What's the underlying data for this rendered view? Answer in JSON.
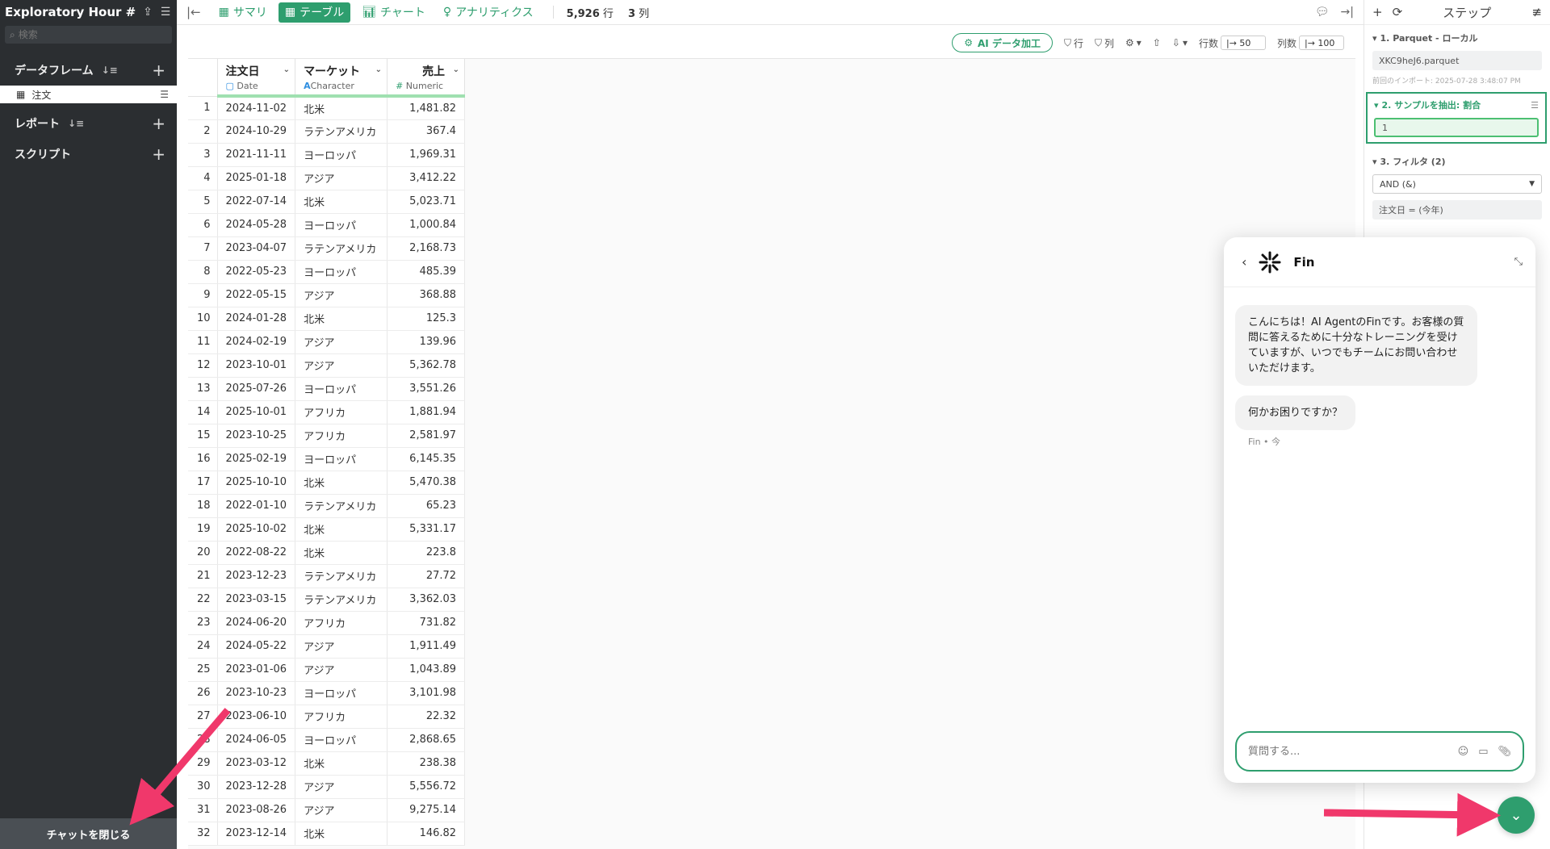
{
  "sidebar": {
    "title": "Exploratory Hour #...",
    "search_placeholder": "検索",
    "dataframes_label": "データフレーム",
    "dataframe_item": "注文",
    "reports_label": "レポート",
    "scripts_label": "スクリプト",
    "close_chat_label": "チャットを閉じる"
  },
  "toolbar": {
    "tabs": [
      "サマリ",
      "テーブル",
      "チャート",
      "アナリティクス"
    ],
    "rows_count": "5,926",
    "rows_unit": "行",
    "cols_count": "3",
    "cols_unit": "列"
  },
  "toolbar2": {
    "ai_label": "AI データ加工",
    "row_filter": "行",
    "col_filter": "列",
    "rows_label": "行数",
    "rows_value": "50",
    "cols_label": "列数",
    "cols_value": "100"
  },
  "table": {
    "columns": [
      {
        "name": "注文日",
        "type": "Date"
      },
      {
        "name": "マーケット",
        "type": "Character"
      },
      {
        "name": "売上",
        "type": "Numeric"
      }
    ],
    "rows": [
      [
        "1",
        "2024-11-02",
        "北米",
        "1,481.82"
      ],
      [
        "2",
        "2024-10-29",
        "ラテンアメリカ",
        "367.4"
      ],
      [
        "3",
        "2021-11-11",
        "ヨーロッパ",
        "1,969.31"
      ],
      [
        "4",
        "2025-01-18",
        "アジア",
        "3,412.22"
      ],
      [
        "5",
        "2022-07-14",
        "北米",
        "5,023.71"
      ],
      [
        "6",
        "2024-05-28",
        "ヨーロッパ",
        "1,000.84"
      ],
      [
        "7",
        "2023-04-07",
        "ラテンアメリカ",
        "2,168.73"
      ],
      [
        "8",
        "2022-05-23",
        "ヨーロッパ",
        "485.39"
      ],
      [
        "9",
        "2022-05-15",
        "アジア",
        "368.88"
      ],
      [
        "10",
        "2024-01-28",
        "北米",
        "125.3"
      ],
      [
        "11",
        "2024-02-19",
        "アジア",
        "139.96"
      ],
      [
        "12",
        "2023-10-01",
        "アジア",
        "5,362.78"
      ],
      [
        "13",
        "2025-07-26",
        "ヨーロッパ",
        "3,551.26"
      ],
      [
        "14",
        "2025-10-01",
        "アフリカ",
        "1,881.94"
      ],
      [
        "15",
        "2023-10-25",
        "アフリカ",
        "2,581.97"
      ],
      [
        "16",
        "2025-02-19",
        "ヨーロッパ",
        "6,145.35"
      ],
      [
        "17",
        "2025-10-10",
        "北米",
        "5,470.38"
      ],
      [
        "18",
        "2022-01-10",
        "ラテンアメリカ",
        "65.23"
      ],
      [
        "19",
        "2025-10-02",
        "北米",
        "5,331.17"
      ],
      [
        "20",
        "2022-08-22",
        "北米",
        "223.8"
      ],
      [
        "21",
        "2023-12-23",
        "ラテンアメリカ",
        "27.72"
      ],
      [
        "22",
        "2023-03-15",
        "ラテンアメリカ",
        "3,362.03"
      ],
      [
        "23",
        "2024-06-20",
        "アフリカ",
        "731.82"
      ],
      [
        "24",
        "2024-05-22",
        "アジア",
        "1,911.49"
      ],
      [
        "25",
        "2023-01-06",
        "アジア",
        "1,043.89"
      ],
      [
        "26",
        "2023-10-23",
        "ヨーロッパ",
        "3,101.98"
      ],
      [
        "27",
        "2023-06-10",
        "アフリカ",
        "22.32"
      ],
      [
        "28",
        "2024-06-05",
        "ヨーロッパ",
        "2,868.65"
      ],
      [
        "29",
        "2023-03-12",
        "北米",
        "238.38"
      ],
      [
        "30",
        "2023-12-28",
        "アジア",
        "5,556.72"
      ],
      [
        "31",
        "2023-08-26",
        "アジア",
        "9,275.14"
      ],
      [
        "32",
        "2023-12-14",
        "北米",
        "146.82"
      ]
    ]
  },
  "steps": {
    "title": "ステップ",
    "items": [
      {
        "title": "1. Parquet - ローカル",
        "value": "XKC9heJ6.parquet",
        "meta": "前回のインポート: 2025-07-28 3:48:07 PM"
      },
      {
        "title": "2. サンプルを抽出: 割合",
        "value": "1"
      },
      {
        "title": "3. フィルタ (2)",
        "select": "AND (&)",
        "value": "注文日 = (今年)"
      }
    ]
  },
  "chat": {
    "name": "Fin",
    "message1": "こんにちは！AI AgentのFinです。お客様の質問に答えるために十分なトレーニングを受けていますが、いつでもチームにお問い合わせいただけます。",
    "message2": "何かお困りですか？",
    "meta": "Fin • 今",
    "input_placeholder": "質問する..."
  },
  "colors": {
    "accent": "#2e9e6e",
    "annotation_arrow": "#f0386b"
  }
}
